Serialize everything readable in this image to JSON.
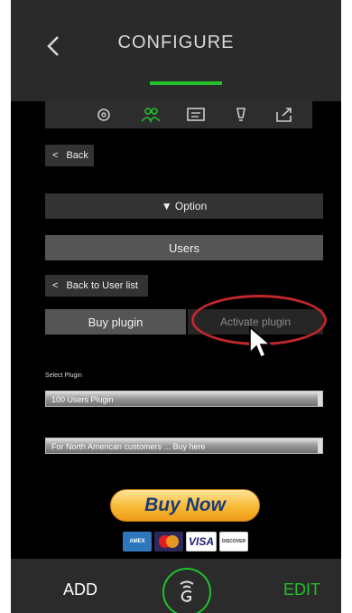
{
  "header": {
    "title": "CONFIGURE"
  },
  "nav_icons": [
    "gear-icon",
    "users-icon",
    "message-icon",
    "bulb-icon",
    "export-icon"
  ],
  "back_btn": {
    "lt": "<",
    "label": "Back"
  },
  "option_btn": {
    "label": "▼ Option"
  },
  "users_btn": {
    "label": "Users"
  },
  "back_user_list": {
    "lt": "<",
    "label": "Back to User list"
  },
  "tabs": {
    "buy": "Buy plugin",
    "activate": "Activate plugin"
  },
  "select": {
    "label": "Select Plugin",
    "first": "100 Users Plugin",
    "second": "For North American customers ... Buy here"
  },
  "buy_now": {
    "label": "Buy Now"
  },
  "cards": [
    "AMEX",
    "MasterCard",
    "VISA",
    "DISCOVER"
  ],
  "footer": {
    "add": "ADD",
    "edit": "EDIT"
  },
  "colors": {
    "accent": "#22c02a",
    "highlight": "#c0272d",
    "buy_now_text": "#1b3a7a"
  }
}
